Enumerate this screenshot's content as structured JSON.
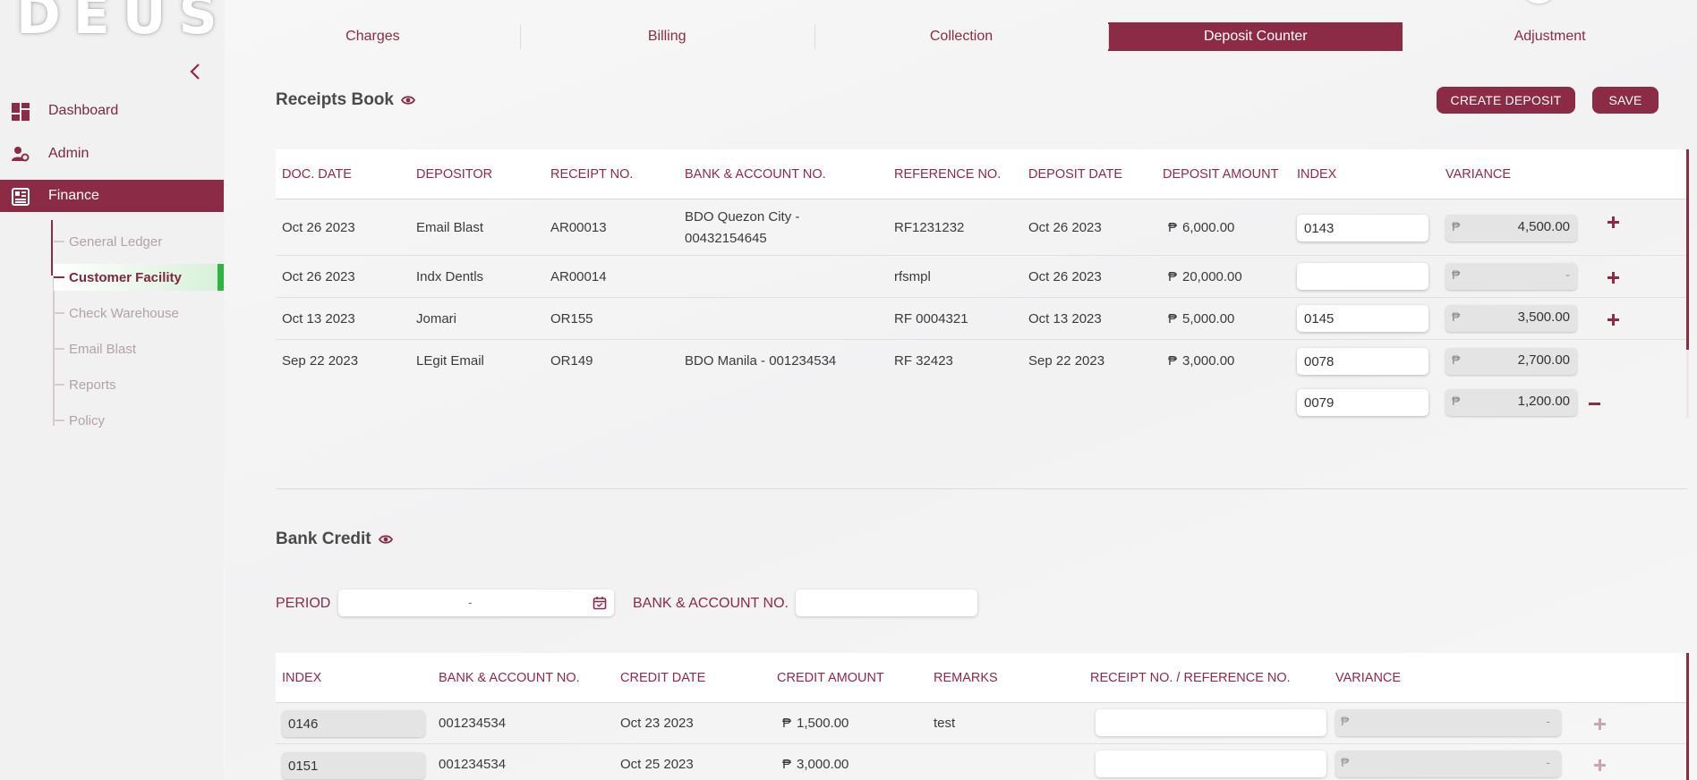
{
  "app": {
    "logo_text": "DEUS"
  },
  "sidebar": {
    "items": [
      {
        "label": "Dashboard",
        "icon": "dashboard-icon"
      },
      {
        "label": "Admin",
        "icon": "admin-icon"
      },
      {
        "label": "Finance",
        "icon": "finance-icon",
        "active": true
      }
    ],
    "finance_sub": [
      {
        "label": "General Ledger"
      },
      {
        "label": "Customer Facility",
        "active": true
      },
      {
        "label": "Check Warehouse"
      },
      {
        "label": "Email Blast"
      },
      {
        "label": "Reports"
      },
      {
        "label": "Policy"
      }
    ]
  },
  "tabs": [
    {
      "label": "Charges"
    },
    {
      "label": "Billing"
    },
    {
      "label": "Collection"
    },
    {
      "label": "Deposit Counter",
      "active": true
    },
    {
      "label": "Adjustment"
    }
  ],
  "receipts": {
    "title": "Receipts Book",
    "create_label": "CREATE DEPOSIT",
    "save_label": "SAVE",
    "columns": [
      "DOC. DATE",
      "DEPOSITOR",
      "RECEIPT NO.",
      "BANK & ACCOUNT NO.",
      "REFERENCE NO.",
      "DEPOSIT DATE",
      "DEPOSIT AMOUNT",
      "INDEX",
      "VARIANCE"
    ],
    "currency": "₱",
    "rows": [
      {
        "doc_date": "Oct 26 2023",
        "depositor": "Email Blast",
        "receipt_no": "AR00013",
        "bank": "BDO Quezon City - 00432154645",
        "reference": "RF1231232",
        "deposit_date": "Oct 26 2023",
        "amount": "6,000.00",
        "index": "0143",
        "variance": "4,500.00"
      },
      {
        "doc_date": "Oct 26 2023",
        "depositor": "Indx Dentls",
        "receipt_no": "AR00014",
        "bank": "",
        "reference": "rfsmpl",
        "deposit_date": "Oct 26 2023",
        "amount": "20,000.00",
        "index": "",
        "variance": "-"
      },
      {
        "doc_date": "Oct 13 2023",
        "depositor": "Jomari",
        "receipt_no": "OR155",
        "bank": "",
        "reference": "RF 0004321",
        "deposit_date": "Oct 13 2023",
        "amount": "5,000.00",
        "index": "0145",
        "variance": "3,500.00"
      },
      {
        "doc_date": "Sep 22 2023",
        "depositor": "LEgit Email",
        "receipt_no": "OR149",
        "bank": "BDO Manila - 001234534",
        "reference": "RF 32423",
        "deposit_date": "Sep 22 2023",
        "amount": "3,000.00",
        "index": "0078",
        "variance": "2,700.00"
      }
    ],
    "extra_split": {
      "index": "0079",
      "variance": "1,200.00"
    }
  },
  "bank_credit": {
    "title": "Bank Credit",
    "period_label": "PERIOD",
    "period_value": "-",
    "bank_label": "BANK & ACCOUNT NO.",
    "columns": [
      "INDEX",
      "BANK & ACCOUNT NO.",
      "CREDIT DATE",
      "CREDIT AMOUNT",
      "REMARKS",
      "RECEIPT NO. / REFERENCE NO.",
      "VARIANCE"
    ],
    "rows": [
      {
        "index": "0146",
        "bank": "001234534",
        "credit_date": "Oct 23 2023",
        "amount": "1,500.00",
        "remarks": "test",
        "variance": "-"
      },
      {
        "index": "0151",
        "bank": "001234534",
        "credit_date": "Oct 25 2023",
        "amount": "3,000.00",
        "remarks": "",
        "variance": "-"
      }
    ]
  },
  "colors": {
    "accent": "#8c2b46",
    "active_marker": "#2fb344"
  }
}
